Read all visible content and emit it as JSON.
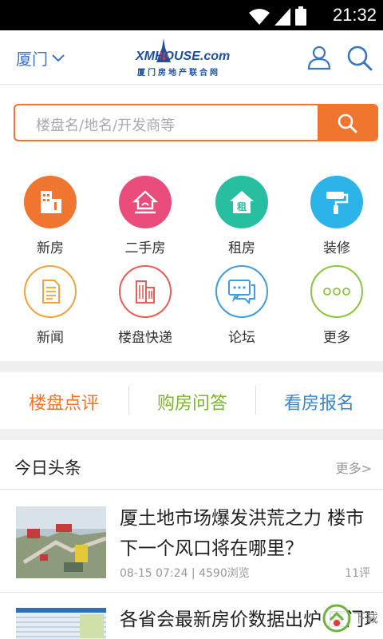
{
  "status_bar": {
    "time": "21:32"
  },
  "header": {
    "city": "厦门",
    "logo_main": "XMHOUSE.com",
    "logo_sub": "厦门房地产联合网"
  },
  "search": {
    "placeholder": "楼盘名/地名/开发商等"
  },
  "categories": [
    {
      "label": "新房",
      "icon": "building-icon",
      "color": "#f0762f"
    },
    {
      "label": "二手房",
      "icon": "house-hand-icon",
      "color": "#ea4c7c"
    },
    {
      "label": "租房",
      "icon": "rent-house-icon",
      "color": "#27bfa0"
    },
    {
      "label": "装修",
      "icon": "paint-roller-icon",
      "color": "#2cb4e9"
    },
    {
      "label": "新闻",
      "icon": "news-document-icon",
      "color": "#f2a33a"
    },
    {
      "label": "楼盘快递",
      "icon": "buildings-outline-icon",
      "color": "#ea5c55"
    },
    {
      "label": "论坛",
      "icon": "chat-bubbles-icon",
      "color": "#3c9ee0"
    },
    {
      "label": "更多",
      "icon": "more-dots-icon",
      "color": "#8dc43f"
    }
  ],
  "quick_links": [
    {
      "label": "楼盘点评",
      "color": "#f0762f"
    },
    {
      "label": "购房问答",
      "color": "#7bb52c"
    },
    {
      "label": "看房报名",
      "color": "#3a86c8"
    }
  ],
  "headlines": {
    "title": "今日头条",
    "more": "更多>",
    "items": [
      {
        "title": "厦土地市场爆发洪荒之力 楼市下一个风口将在哪里？",
        "meta": "08-15 07:24 | 4590浏览",
        "comments": "11评"
      },
      {
        "title": "各省会最新房价数据出炉 厦门环..."
      }
    ]
  },
  "watermark": "下载"
}
